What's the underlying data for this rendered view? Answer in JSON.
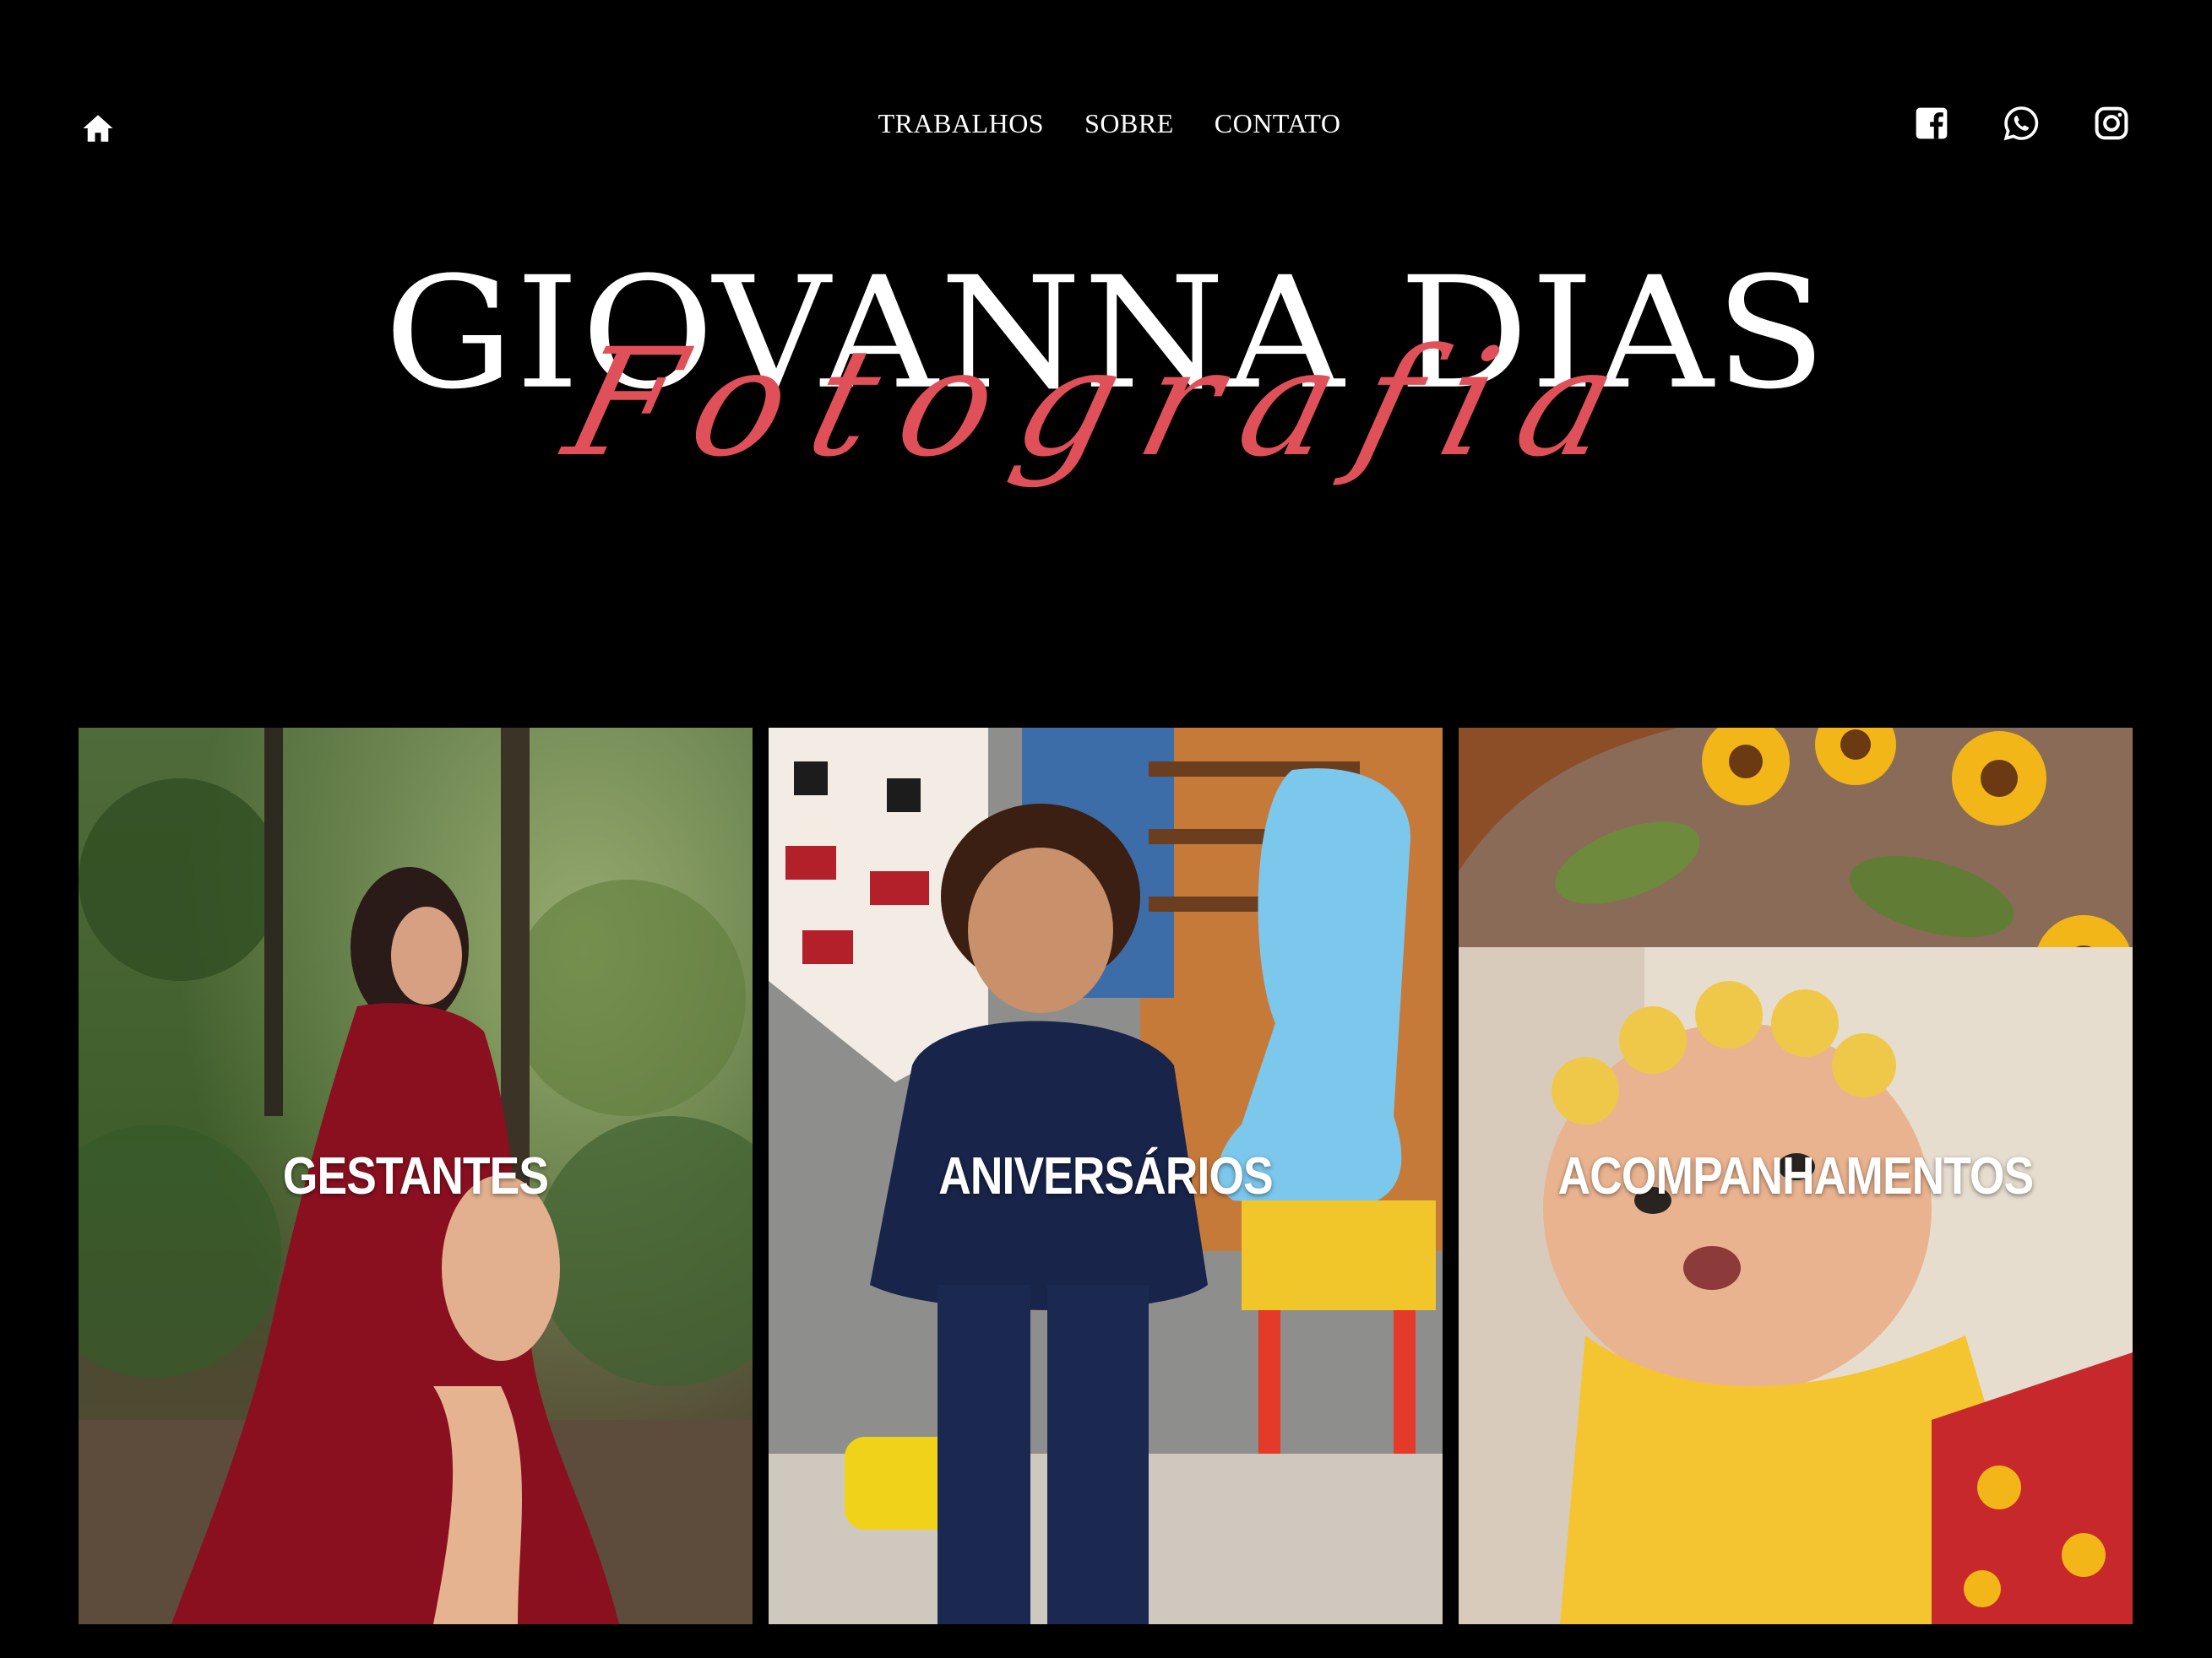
{
  "nav": {
    "home_icon": "home-icon",
    "links": [
      {
        "label": "TRABALHOS"
      },
      {
        "label": "SOBRE"
      },
      {
        "label": "CONTATO"
      }
    ]
  },
  "social": {
    "icons": [
      "facebook-icon",
      "whatsapp-icon",
      "instagram-icon"
    ]
  },
  "logo": {
    "title": "GIOVANNA DIAS",
    "subtitle": "Fotografia",
    "title_color": "#ffffff",
    "subtitle_color": "#e05058"
  },
  "cards": [
    {
      "label": "GESTANTES"
    },
    {
      "label": "ANIVERSÁRIOS"
    },
    {
      "label": "ACOMPANHAMENTOS"
    }
  ],
  "colors": {
    "background": "#000000",
    "text": "#ffffff",
    "accent": "#e05058"
  }
}
